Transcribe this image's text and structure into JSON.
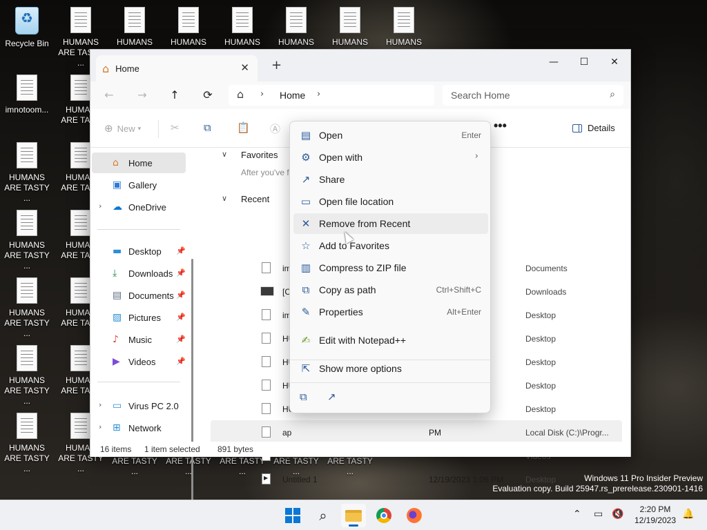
{
  "desktop": {
    "icons": [
      {
        "label": "Recycle Bin",
        "label2": "",
        "type": "bin"
      },
      {
        "label": "HUMANS",
        "label2": "ARE TASTY ...",
        "type": "doc"
      },
      {
        "label": "HUMANS",
        "label2": "",
        "type": "doc"
      },
      {
        "label": "HUMANS",
        "label2": "",
        "type": "doc"
      },
      {
        "label": "HUMANS",
        "label2": "",
        "type": "doc"
      },
      {
        "label": "HUMANS",
        "label2": "",
        "type": "doc"
      },
      {
        "label": "HUMANS",
        "label2": "",
        "type": "doc"
      },
      {
        "label": "HUMANS",
        "label2": "",
        "type": "doc"
      },
      {
        "label": "imnotoom...",
        "label2": "",
        "type": "doc"
      },
      {
        "label": "HUMAN",
        "label2": "ARE TAST",
        "type": "doc"
      },
      {
        "label": "HUMANS",
        "label2": "ARE TASTY ...",
        "type": "doc"
      },
      {
        "label": "HUMAN",
        "label2": "ARE TAST",
        "type": "doc"
      },
      {
        "label": "HUMANS",
        "label2": "ARE TASTY ...",
        "type": "doc"
      },
      {
        "label": "HUMAN",
        "label2": "ARE TAST",
        "type": "doc"
      },
      {
        "label": "HUMANS",
        "label2": "ARE TASTY ...",
        "type": "doc"
      },
      {
        "label": "HUMAN",
        "label2": "ARE TAST",
        "type": "doc"
      },
      {
        "label": "HUMANS",
        "label2": "ARE TASTY ...",
        "type": "doc"
      },
      {
        "label": "HUMAN",
        "label2": "ARE TAST",
        "type": "doc"
      },
      {
        "label": "HUMANS",
        "label2": "ARE TASTY ...",
        "type": "doc"
      },
      {
        "label": "HUMAN",
        "label2": "ARE TASTY ...",
        "type": "doc"
      }
    ],
    "overflow_labels": [
      "ARE TASTY ...",
      "ARE TASTY ...",
      "ARE TASTY ...",
      "ARE TASTY ...",
      "ARE TASTY ..."
    ]
  },
  "window": {
    "tab_title": "Home",
    "tab_close": "✕",
    "new_tab": "+",
    "controls": {
      "minimize": "—",
      "maximize": "☐",
      "close": "✕"
    },
    "nav": {
      "back": "←",
      "forward": "→",
      "up": "↑",
      "refresh": "⟳"
    },
    "address": {
      "crumb": "Home",
      "chevron": "›"
    },
    "search": {
      "placeholder": "Search Home",
      "icon": "⌕"
    },
    "command": {
      "new_label": "New",
      "more": "•••",
      "details_label": "Details"
    },
    "sidebar": {
      "items": [
        {
          "label": "Home",
          "icon": "home-icon",
          "selected": true
        },
        {
          "label": "Gallery",
          "icon": "gallery-icon"
        },
        {
          "label": "OneDrive",
          "icon": "cloud-icon",
          "expandable": true
        },
        {
          "label": "Desktop",
          "icon": "desktop-icon",
          "pinned": true
        },
        {
          "label": "Downloads",
          "icon": "download-icon",
          "pinned": true
        },
        {
          "label": "Documents",
          "icon": "documents-icon",
          "pinned": true
        },
        {
          "label": "Pictures",
          "icon": "pictures-icon",
          "pinned": true
        },
        {
          "label": "Music",
          "icon": "music-icon",
          "pinned": true
        },
        {
          "label": "Videos",
          "icon": "videos-icon",
          "pinned": true
        },
        {
          "label": "Virus PC 2.0",
          "icon": "pc-icon",
          "expandable": true
        },
        {
          "label": "Network",
          "icon": "network-icon",
          "expandable": true
        }
      ]
    },
    "content": {
      "favorites_header": "Favorites",
      "favorites_hint": "After you've f",
      "recent_header": "Recent",
      "rows": [
        {
          "name": "im",
          "date": "PM",
          "location": "Documents",
          "icon": "text"
        },
        {
          "name": "[C",
          "date": "PM",
          "location": "Downloads",
          "icon": "image"
        },
        {
          "name": "im",
          "date": "PM",
          "location": "Desktop",
          "icon": "text"
        },
        {
          "name": "HU",
          "date": "PM",
          "location": "Desktop",
          "icon": "text"
        },
        {
          "name": "HU",
          "date": "PM",
          "location": "Desktop",
          "icon": "text"
        },
        {
          "name": "HU",
          "date": "PM",
          "location": "Desktop",
          "icon": "text"
        },
        {
          "name": "HU",
          "date": "PM",
          "location": "Desktop",
          "icon": "text"
        },
        {
          "name": "ap",
          "date": "PM",
          "location": "Local Disk (C:)\\Progr...",
          "icon": "text",
          "selected": true
        },
        {
          "name": "Ur",
          "date": "PM",
          "location": "Videos",
          "icon": "media"
        },
        {
          "name": "Untitled 1",
          "date": "12/19/2023 1:06 PM",
          "location": "Desktop",
          "icon": "media"
        }
      ]
    },
    "status": {
      "count": "16 items",
      "selected": "1 item selected",
      "size": "891 bytes"
    }
  },
  "context_menu": {
    "items": [
      {
        "label": "Open",
        "accel": "Enter",
        "icon": "open-icon",
        "glyph": "▤"
      },
      {
        "label": "Open with",
        "accel": "",
        "icon": "open-with-icon",
        "glyph": "⚙",
        "submenu": true
      },
      {
        "label": "Share",
        "accel": "",
        "icon": "share-icon",
        "glyph": "↗"
      },
      {
        "label": "Open file location",
        "accel": "",
        "icon": "folder-icon",
        "glyph": "▭"
      },
      {
        "label": "Remove from Recent",
        "accel": "",
        "icon": "x-icon",
        "glyph": "✕",
        "hover": true
      },
      {
        "label": "Add to Favorites",
        "accel": "",
        "icon": "star-icon",
        "glyph": "☆"
      },
      {
        "label": "Compress to ZIP file",
        "accel": "",
        "icon": "zip-icon",
        "glyph": "▥"
      },
      {
        "label": "Copy as path",
        "accel": "Ctrl+Shift+C",
        "icon": "copy-path-icon",
        "glyph": "⧉"
      },
      {
        "label": "Properties",
        "accel": "Alt+Enter",
        "icon": "wrench-icon",
        "glyph": "✎"
      },
      {
        "label": "Edit with Notepad++",
        "accel": "",
        "icon": "notepad-icon",
        "glyph": "✍"
      },
      {
        "label": "Show more options",
        "accel": "",
        "icon": "more-options-icon",
        "glyph": "⇱"
      }
    ],
    "submenu_arrow": "›",
    "bottom_copy": "⧉",
    "bottom_share": "↗"
  },
  "watermark": {
    "line1": "Windows 11 Pro Insider Preview",
    "line2": "Evaluation copy. Build 25947.rs_prerelease.230901-1416"
  },
  "taskbar": {
    "time": "2:20 PM",
    "date": "12/19/2023",
    "tray": {
      "chevron": "⌃",
      "bell": "🔔"
    }
  },
  "colors": {
    "accent": "#0067c0",
    "selection": "#e6e6e6",
    "menu_bg": "#f9f9f9"
  }
}
